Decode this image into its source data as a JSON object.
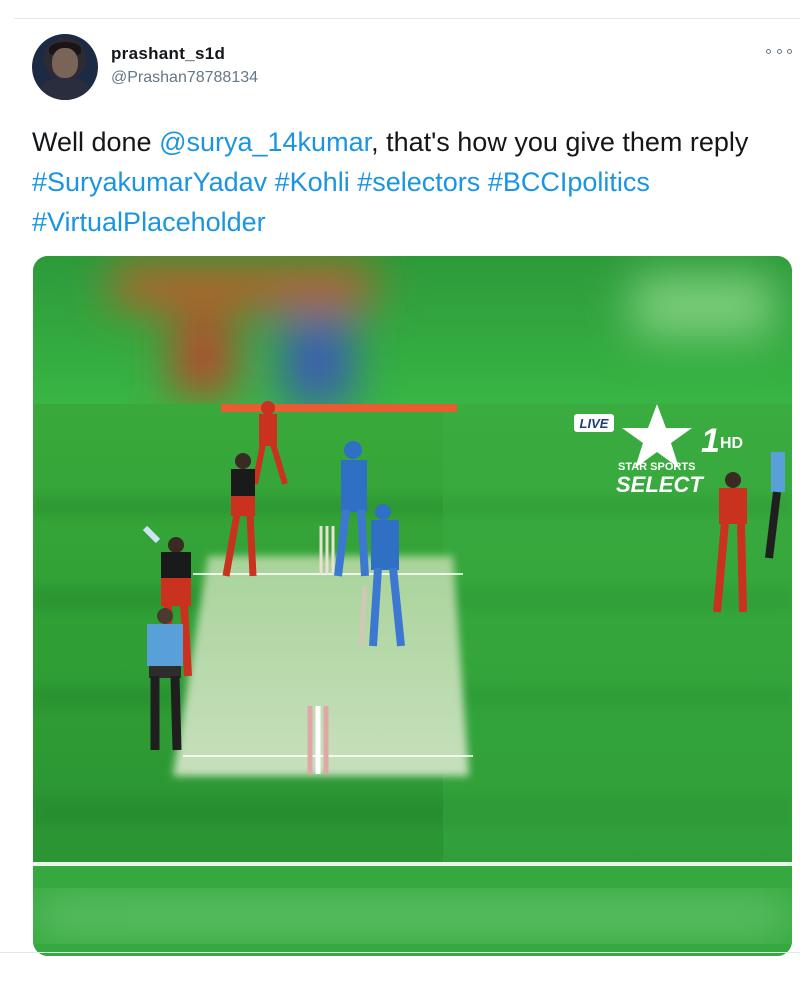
{
  "tweet": {
    "author": {
      "display_name": "prashant_s1d",
      "handle": "@Prashan78788134"
    },
    "text": {
      "prefix": "Well done ",
      "mention": "@surya_14kumar",
      "middle": ", that's how you give them reply ",
      "hashtags": [
        "#SuryakumarYadav",
        "#Kohli",
        "#selectors",
        "#BCCIpolitics",
        "#VirtualPlaceholder"
      ]
    },
    "media": {
      "overlay": {
        "live_badge": "LIVE",
        "channel_number": "1",
        "channel_hd": "HD",
        "channel_line1": "STAR SPORTS",
        "channel_line2": "SELECT"
      }
    }
  },
  "colors": {
    "link": "#1b95e0",
    "text": "#14171a",
    "muted": "#657786",
    "field": "#2fa83a",
    "team_red": "#c8321e",
    "team_blue": "#2f6fc4"
  },
  "icons": {
    "more": "more-options-icon"
  }
}
